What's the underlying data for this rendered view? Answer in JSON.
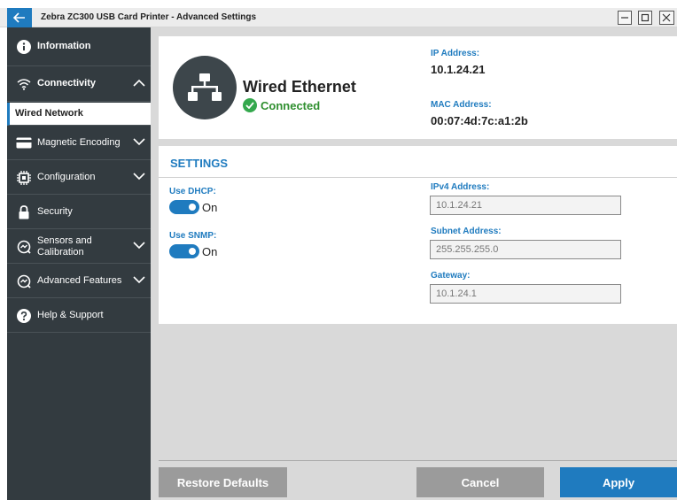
{
  "window": {
    "title": "Zebra ZC300 USB Card Printer - Advanced Settings",
    "back_icon": "arrow-left-icon",
    "controls": [
      "minimize-icon",
      "maximize-icon",
      "close-icon"
    ]
  },
  "sidebar": {
    "items": [
      {
        "label": "Information",
        "icon": "info-icon",
        "expanded": null
      },
      {
        "label": "Connectivity",
        "icon": "wifi-icon",
        "expanded": true
      },
      {
        "label": "Wired Network",
        "icon": null,
        "selected": true
      },
      {
        "label": "Magnetic Encoding",
        "icon": "card-icon",
        "expanded": false
      },
      {
        "label": "Configuration",
        "icon": "chip-icon",
        "expanded": false
      },
      {
        "label": "Security",
        "icon": "lock-icon",
        "expanded": null
      },
      {
        "label": "Sensors and Calibration",
        "label_line1": "Sensors and",
        "label_line2": "Calibration",
        "icon": "gauge-icon",
        "expanded": false
      },
      {
        "label": "Advanced Features",
        "icon": "gauge-icon",
        "expanded": false
      },
      {
        "label": "Help & Support",
        "icon": "help-icon",
        "expanded": null
      }
    ]
  },
  "status": {
    "icon": "network-icon",
    "title": "Wired Ethernet",
    "state": "Connected",
    "ip_label": "IP Address:",
    "ip_value": "10.1.24.21",
    "mac_label": "MAC Address:",
    "mac_value": "00:07:4d:7c:a1:2b"
  },
  "settings": {
    "header": "SETTINGS",
    "dhcp": {
      "label": "Use DHCP:",
      "state": "On",
      "enabled": true
    },
    "snmp": {
      "label": "Use SNMP:",
      "state": "On",
      "enabled": true
    },
    "ipv4": {
      "label": "IPv4 Address:",
      "value": "10.1.24.21"
    },
    "subnet": {
      "label": "Subnet Address:",
      "value": "255.255.255.0"
    },
    "gateway": {
      "label": "Gateway:",
      "value": "10.1.24.1"
    }
  },
  "footer": {
    "restore_label": "Restore Defaults",
    "cancel_label": "Cancel",
    "apply_label": "Apply"
  },
  "colors": {
    "accent": "#1f7bbf",
    "sidebar_bg": "#333b40",
    "success": "#34a84d",
    "disabled_button": "#9b9b9b"
  }
}
